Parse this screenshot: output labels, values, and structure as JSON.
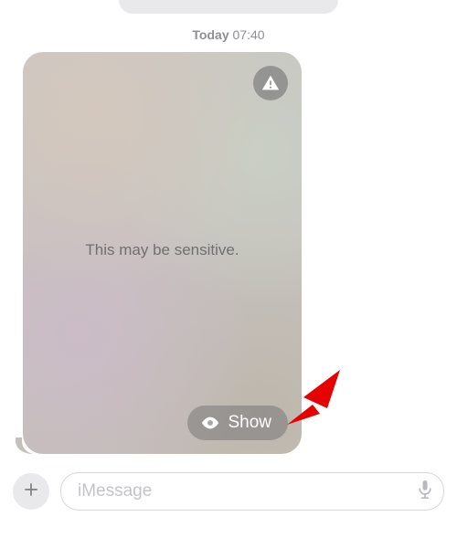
{
  "timestamp": {
    "day": "Today",
    "time": "07:40"
  },
  "sensitive": {
    "message": "This may be sensitive.",
    "show_label": "Show"
  },
  "compose": {
    "placeholder": "iMessage"
  }
}
